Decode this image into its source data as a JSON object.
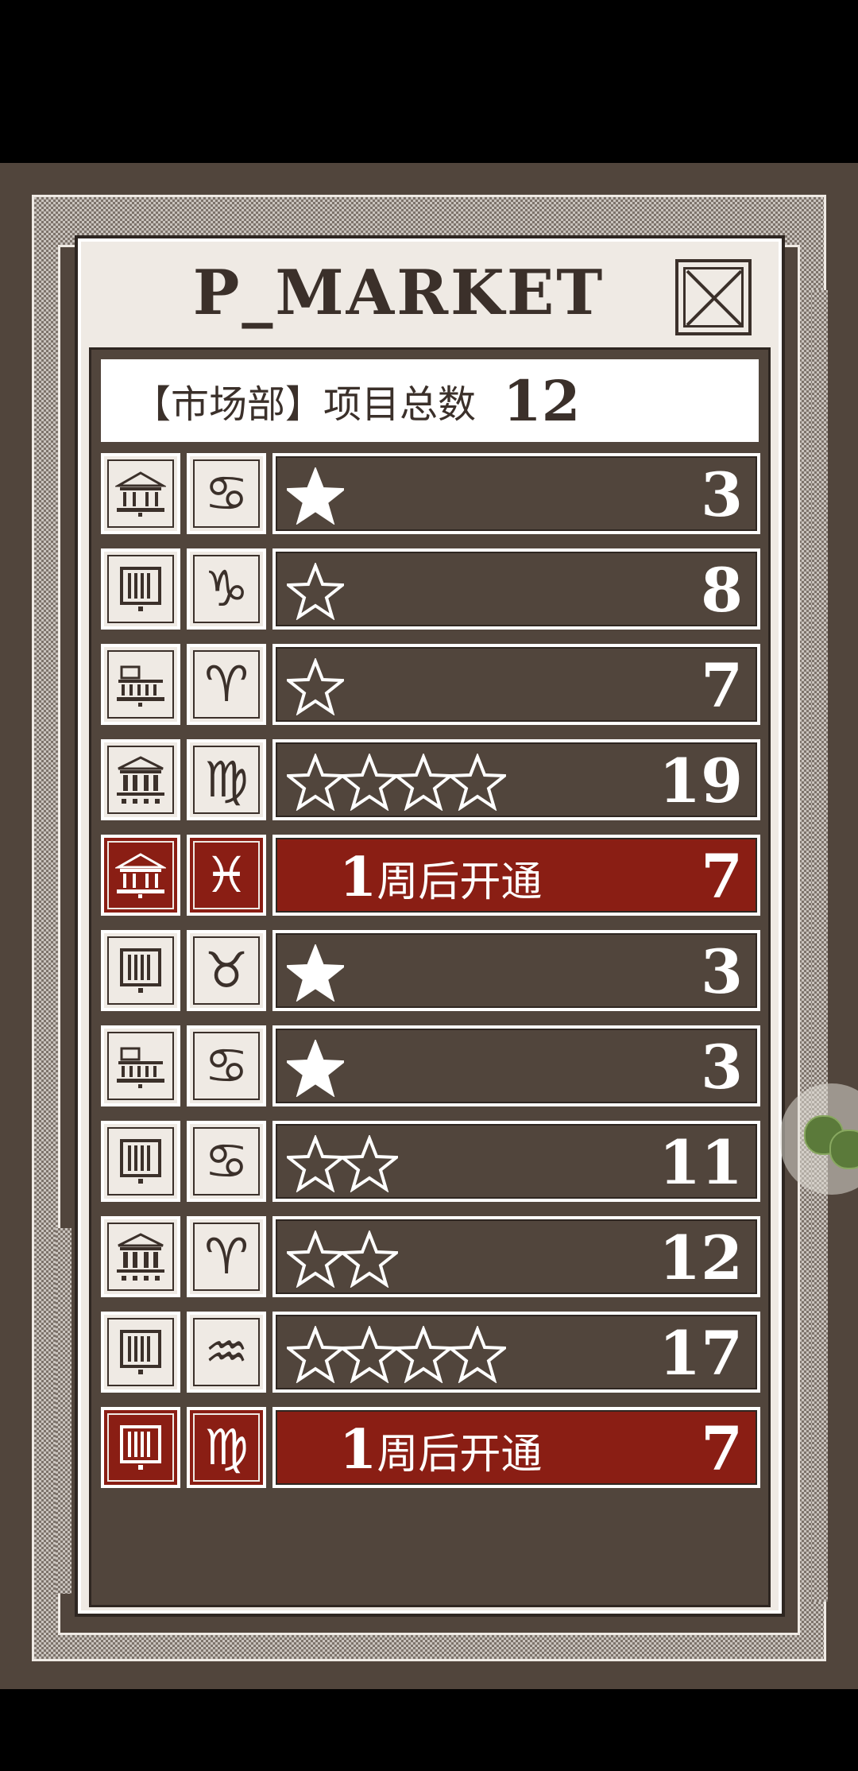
{
  "panel": {
    "title": "P_MARKET",
    "header_label": "【市场部】项目总数",
    "total_count": "12"
  },
  "rows": [
    {
      "building": "temple-building-icon",
      "zodiac": "♋",
      "zodiac_name": "cancer-icon",
      "stars": 1,
      "stars_filled": true,
      "value": "3",
      "locked": false
    },
    {
      "building": "tall-building-icon",
      "zodiac": "♑",
      "zodiac_name": "capricorn-icon",
      "stars": 1,
      "stars_filled": false,
      "value": "8",
      "locked": false
    },
    {
      "building": "factory-building-icon",
      "zodiac": "♈",
      "zodiac_name": "aries-icon",
      "stars": 1,
      "stars_filled": false,
      "value": "7",
      "locked": false
    },
    {
      "building": "bank-building-icon",
      "zodiac": "♍",
      "zodiac_name": "virgo-icon",
      "stars": 4,
      "stars_filled": false,
      "value": "19",
      "locked": false
    },
    {
      "building": "temple-building-icon",
      "zodiac": "♓",
      "zodiac_name": "pisces-icon",
      "stars": 0,
      "stars_filled": false,
      "value": "7",
      "locked": true,
      "notice_num": "1",
      "notice_text": "周后开通"
    },
    {
      "building": "tall-building-icon",
      "zodiac": "♉",
      "zodiac_name": "taurus-icon",
      "stars": 1,
      "stars_filled": true,
      "value": "3",
      "locked": false
    },
    {
      "building": "factory-building-icon",
      "zodiac": "♋",
      "zodiac_name": "cancer-icon",
      "stars": 1,
      "stars_filled": true,
      "value": "3",
      "locked": false
    },
    {
      "building": "tall-building-icon",
      "zodiac": "♋",
      "zodiac_name": "cancer-icon",
      "stars": 2,
      "stars_filled": false,
      "value": "11",
      "locked": false
    },
    {
      "building": "bank-building-icon",
      "zodiac": "♈",
      "zodiac_name": "aries-icon",
      "stars": 2,
      "stars_filled": false,
      "value": "12",
      "locked": false
    },
    {
      "building": "tall-building-icon",
      "zodiac": "♒",
      "zodiac_name": "aquarius-icon",
      "stars": 4,
      "stars_filled": false,
      "value": "17",
      "locked": false
    },
    {
      "building": "tall-building-icon",
      "zodiac": "♍",
      "zodiac_name": "virgo-icon",
      "stars": 0,
      "stars_filled": false,
      "value": "7",
      "locked": true,
      "notice_num": "1",
      "notice_text": "周后开通"
    }
  ],
  "colors": {
    "background": "#51453c",
    "panel": "#efeae4",
    "locked": "#8a1e14",
    "ink": "#3b302a"
  }
}
